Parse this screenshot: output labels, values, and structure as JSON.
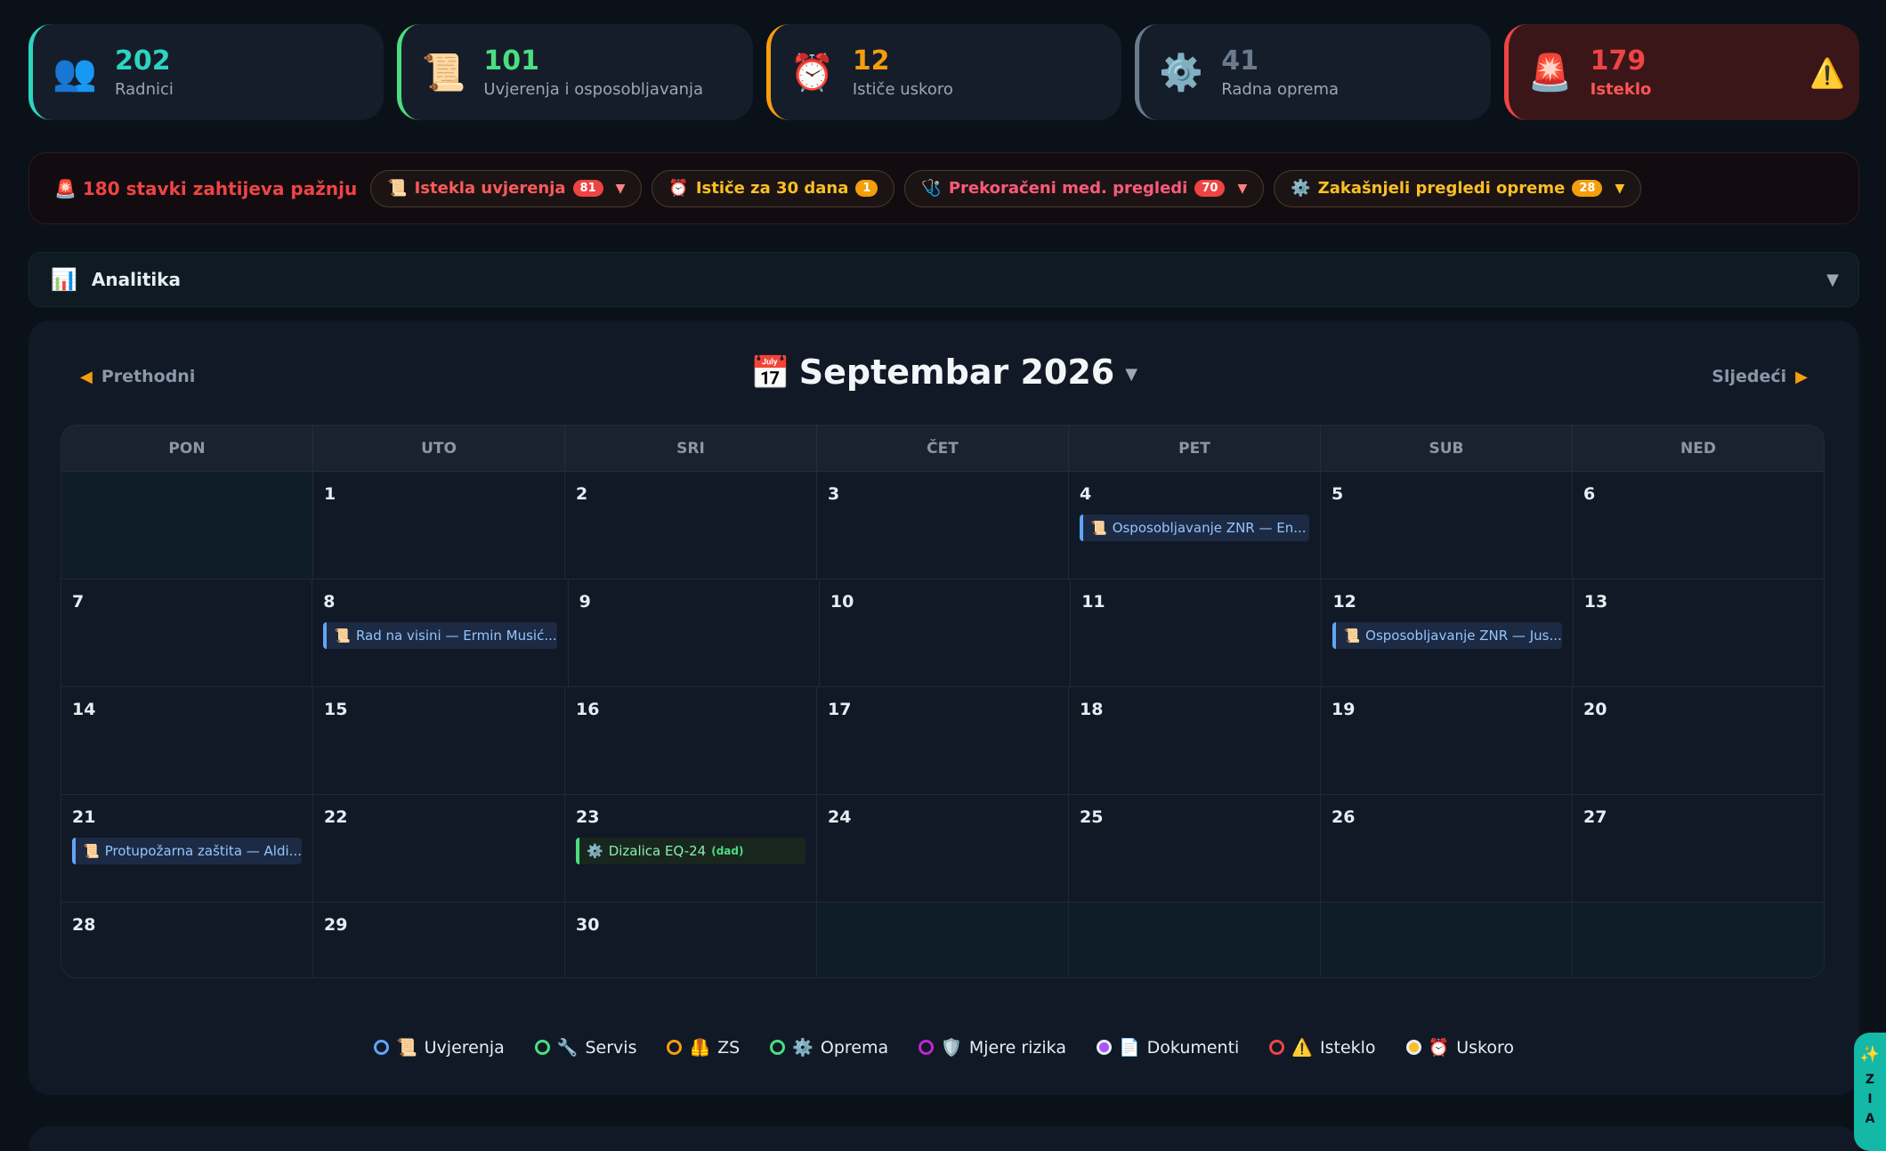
{
  "stats": [
    {
      "icon": "👥",
      "value": "202",
      "label": "Radnici"
    },
    {
      "icon": "📜",
      "value": "101",
      "label": "Uvjerenja i osposobljavanja"
    },
    {
      "icon": "⏰",
      "value": "12",
      "label": "Ističe uskoro"
    },
    {
      "icon": "⚙️",
      "value": "41",
      "label": "Radna oprema"
    },
    {
      "icon": "🚨",
      "value": "179",
      "label": "Isteklo",
      "warning": "⚠️"
    }
  ],
  "alerts": {
    "title": "🚨 180 stavki zahtijeva pažnju",
    "pills": [
      {
        "icon": "📜",
        "label": "Istekla uvjerenja",
        "count": "81",
        "caret": "▼"
      },
      {
        "icon": "⏰",
        "label": "Ističe za 30 dana",
        "count": "1"
      },
      {
        "icon": "🩺",
        "label": "Prekoračeni med. pregledi",
        "count": "70",
        "caret": "▼"
      },
      {
        "icon": "⚙️",
        "label": "Zakašnjeli pregledi opreme",
        "count": "28",
        "caret": "▼"
      }
    ]
  },
  "analytics": {
    "icon": "📊",
    "title": "Analitika",
    "caret": "▼"
  },
  "calendar": {
    "prev_label": "Prethodni",
    "next_label": "Sljedeći",
    "prev_icon": "◀",
    "next_icon": "▶",
    "title_icon": "📅",
    "title": "Septembar 2026",
    "title_caret": "▼",
    "weekdays": [
      "PON",
      "UTO",
      "SRI",
      "ČET",
      "PET",
      "SUB",
      "NED"
    ],
    "weeks": [
      [
        {
          "day": ""
        },
        {
          "day": "1"
        },
        {
          "day": "2"
        },
        {
          "day": "3"
        },
        {
          "day": "4",
          "event": {
            "icon": "📜",
            "text": "Osposobljavanje ZNR — En...",
            "type": "blue"
          }
        },
        {
          "day": "5"
        },
        {
          "day": "6"
        }
      ],
      [
        {
          "day": "7"
        },
        {
          "day": "8",
          "event": {
            "icon": "📜",
            "text": "Rad na visini — Ermin Musić...",
            "type": "blue"
          }
        },
        {
          "day": "9"
        },
        {
          "day": "10"
        },
        {
          "day": "11"
        },
        {
          "day": "12",
          "event": {
            "icon": "📜",
            "text": "Osposobljavanje ZNR — Jus...",
            "type": "blue"
          }
        },
        {
          "day": "13"
        }
      ],
      [
        {
          "day": "14"
        },
        {
          "day": "15"
        },
        {
          "day": "16"
        },
        {
          "day": "17"
        },
        {
          "day": "18"
        },
        {
          "day": "19"
        },
        {
          "day": "20"
        }
      ],
      [
        {
          "day": "21",
          "event": {
            "icon": "📜",
            "text": "Protupožarna zaštita — Aldi...",
            "type": "blue"
          }
        },
        {
          "day": "22"
        },
        {
          "day": "23",
          "event": {
            "icon": "⚙️",
            "text": "Dizalica EQ-24",
            "tag": "(dad)",
            "type": "green"
          }
        },
        {
          "day": "24"
        },
        {
          "day": "25"
        },
        {
          "day": "26"
        },
        {
          "day": "27"
        }
      ],
      [
        {
          "day": "28"
        },
        {
          "day": "29"
        },
        {
          "day": "30"
        },
        {
          "day": ""
        },
        {
          "day": ""
        },
        {
          "day": ""
        },
        {
          "day": ""
        }
      ]
    ]
  },
  "legend": [
    {
      "color": "#60a5fa",
      "icon": "📜",
      "label": "Uvjerenja",
      "style": "ring"
    },
    {
      "color": "#4ade80",
      "icon": "🔧",
      "label": "Servis",
      "style": "ring"
    },
    {
      "color": "#f59e0b",
      "icon": "🦺",
      "label": "ZS",
      "style": "ring"
    },
    {
      "color": "#4ade80",
      "icon": "⚙️",
      "label": "Oprema",
      "style": "ring"
    },
    {
      "color": "#c026d3",
      "icon": "🛡️",
      "label": "Mjere rizika",
      "style": "ring"
    },
    {
      "color": "#a855f7",
      "icon": "📄",
      "label": "Dokumenti",
      "style": "dot"
    },
    {
      "color": "#ef4444",
      "icon": "⚠️",
      "label": "Isteklo",
      "style": "ring"
    },
    {
      "color": "#fbbf24",
      "icon": "⏰",
      "label": "Uskoro",
      "style": "dot"
    }
  ],
  "zia": {
    "icon": "✨",
    "letters": [
      "Z",
      "I",
      "A"
    ]
  }
}
